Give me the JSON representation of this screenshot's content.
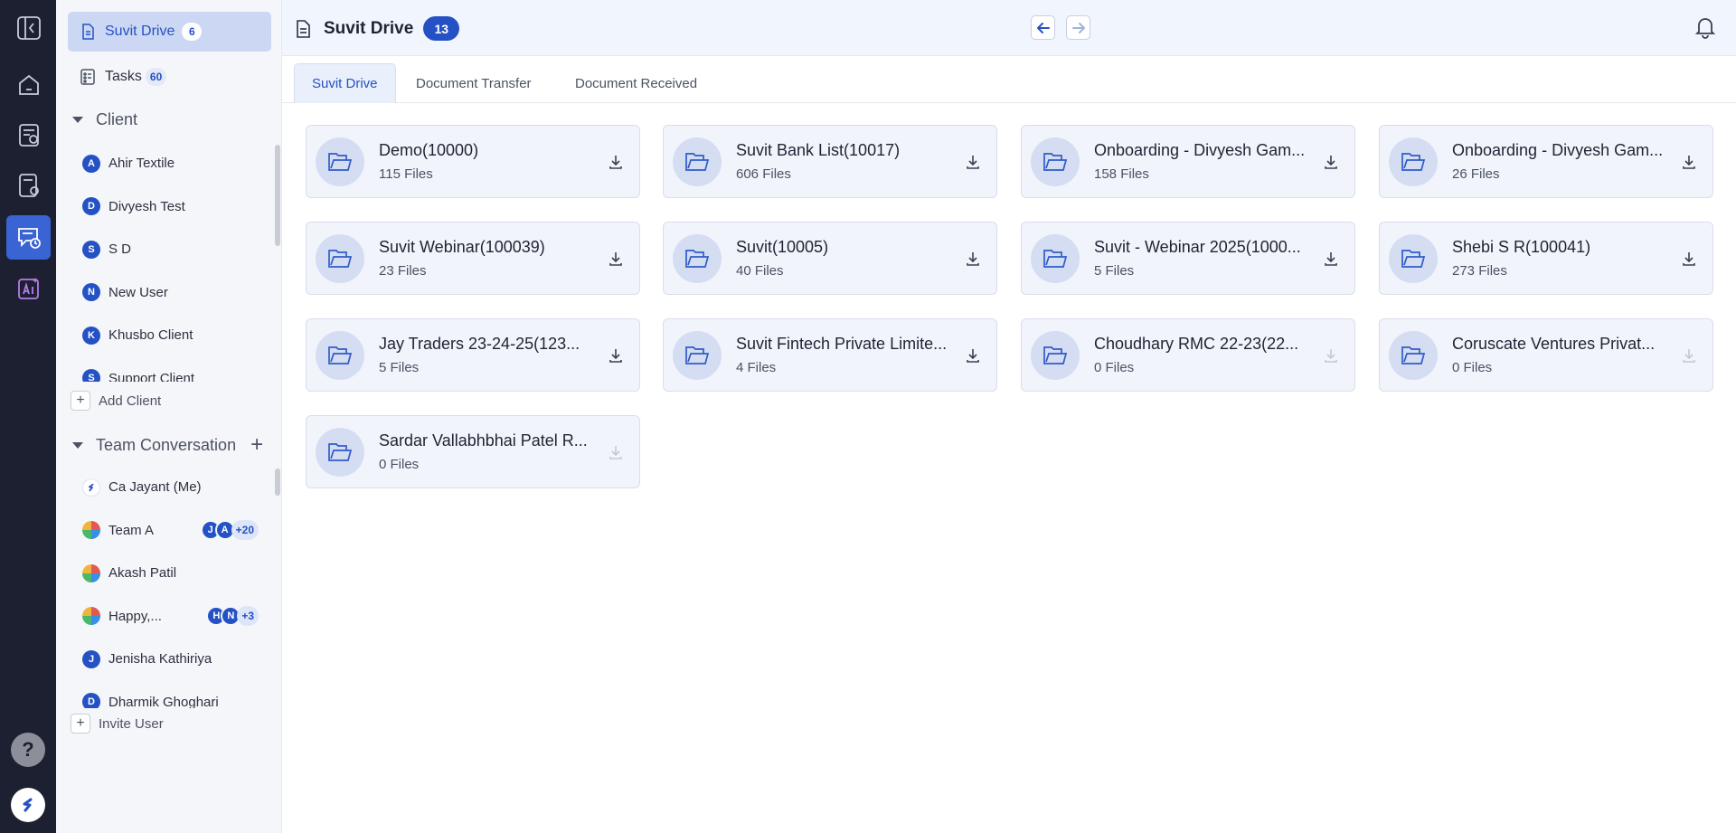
{
  "sidebar": {
    "suvit_drive": {
      "label": "Suvit Drive",
      "count": "6"
    },
    "tasks": {
      "label": "Tasks",
      "count": "60"
    },
    "client_section": {
      "title": "Client"
    },
    "clients": [
      {
        "initial": "A",
        "name": "Ahir Textile"
      },
      {
        "initial": "D",
        "name": "Divyesh Test"
      },
      {
        "initial": "S",
        "name": "S D"
      },
      {
        "initial": "N",
        "name": "New User"
      },
      {
        "initial": "K",
        "name": "Khusbo Client"
      },
      {
        "initial": "S",
        "name": "Support Client"
      }
    ],
    "add_client": "Add Client",
    "team_section": {
      "title": "Team Conversation"
    },
    "team": [
      {
        "initial": "",
        "name": "Ca Jayant (Me)",
        "avatar": "logo"
      },
      {
        "initial": "",
        "name": "Team A",
        "avatar": "img",
        "members": [
          "J",
          "A"
        ],
        "more": "+20"
      },
      {
        "initial": "",
        "name": "Akash Patil",
        "avatar": "img"
      },
      {
        "initial": "",
        "name": "Happy,...",
        "avatar": "img",
        "members": [
          "H",
          "N"
        ],
        "more": "+3"
      },
      {
        "initial": "J",
        "name": "Jenisha Kathiriya"
      },
      {
        "initial": "D",
        "name": "Dharmik Ghoghari"
      }
    ],
    "invite_user": "Invite User"
  },
  "header": {
    "title": "Suvit Drive",
    "count": "13"
  },
  "tabs": [
    {
      "label": "Suvit Drive",
      "active": true
    },
    {
      "label": "Document Transfer",
      "active": false
    },
    {
      "label": "Document Received",
      "active": false
    }
  ],
  "folders": [
    {
      "name": "Demo(10000)",
      "files": "115 Files",
      "enabled": true
    },
    {
      "name": "Suvit Bank List(10017)",
      "files": "606 Files",
      "enabled": true
    },
    {
      "name": "Onboarding - Divyesh Gam...",
      "files": "158 Files",
      "enabled": true
    },
    {
      "name": "Onboarding - Divyesh Gam...",
      "files": "26 Files",
      "enabled": true
    },
    {
      "name": "Suvit Webinar(100039)",
      "files": "23 Files",
      "enabled": true
    },
    {
      "name": "Suvit(10005)",
      "files": "40 Files",
      "enabled": true
    },
    {
      "name": "Suvit - Webinar 2025(1000...",
      "files": "5 Files",
      "enabled": true
    },
    {
      "name": "Shebi S R(100041)",
      "files": "273 Files",
      "enabled": true
    },
    {
      "name": "Jay Traders 23-24-25(123...",
      "files": "5 Files",
      "enabled": true
    },
    {
      "name": "Suvit Fintech Private Limite...",
      "files": "4 Files",
      "enabled": true
    },
    {
      "name": "Choudhary RMC 22-23(22...",
      "files": "0 Files",
      "enabled": false
    },
    {
      "name": "Coruscate Ventures Privat...",
      "files": "0 Files",
      "enabled": false
    },
    {
      "name": "Sardar Vallabhbhai Patel R...",
      "files": "0 Files",
      "enabled": false
    }
  ],
  "rail": {
    "help_label": "?",
    "logo_mark": "s"
  },
  "colors": {
    "accent": "#2451c4",
    "rail": "#1d2030",
    "active_rail": "#3a63d4"
  }
}
